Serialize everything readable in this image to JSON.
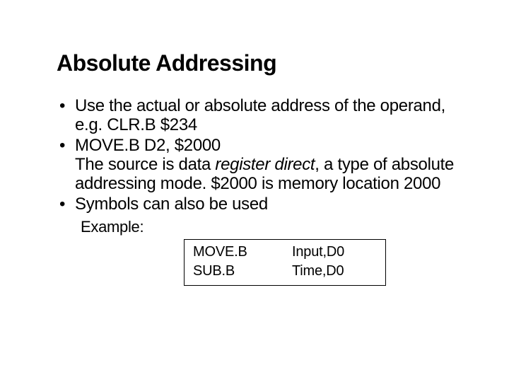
{
  "title": "Absolute Addressing",
  "bullets": {
    "b1": {
      "text": "Use the actual or absolute address of the operand, e.g. CLR.B $234"
    },
    "b2": {
      "line1": "MOVE.B D2, $2000",
      "line2a": "The source is data ",
      "line2b_italic": "register direct",
      "line2c": ", a type of absolute addressing mode. $2000 is memory location 2000"
    },
    "b3": {
      "text": "Symbols can also be used"
    }
  },
  "example": {
    "label": "Example:",
    "rows": [
      {
        "a": "MOVE.B",
        "b": "Input,D0"
      },
      {
        "a": "SUB.B",
        "b": "Time,D0"
      }
    ]
  }
}
